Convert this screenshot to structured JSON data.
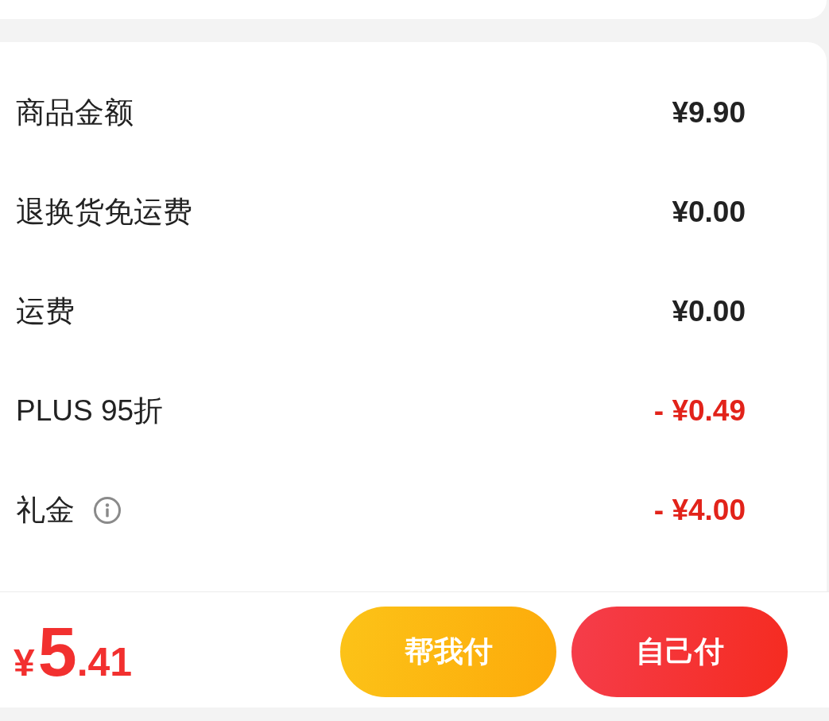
{
  "summary_rows": [
    {
      "label": "商品金额",
      "value": "¥9.90",
      "kind": "amount",
      "info": false
    },
    {
      "label": "退换货免运费",
      "value": "¥0.00",
      "kind": "amount",
      "info": false
    },
    {
      "label": "运费",
      "value": "¥0.00",
      "kind": "amount",
      "info": false
    },
    {
      "label": "PLUS 95折",
      "value": "- ¥0.49",
      "kind": "discount",
      "info": false
    },
    {
      "label": "礼金",
      "value": "- ¥4.00",
      "kind": "discount",
      "info": true
    }
  ],
  "footer": {
    "total": {
      "currency": "¥",
      "integer": "5",
      "fraction": ".41"
    },
    "buttons": [
      {
        "label": "帮我付",
        "kind": "friend_pay"
      },
      {
        "label": "自己付",
        "kind": "self_pay"
      }
    ]
  }
}
